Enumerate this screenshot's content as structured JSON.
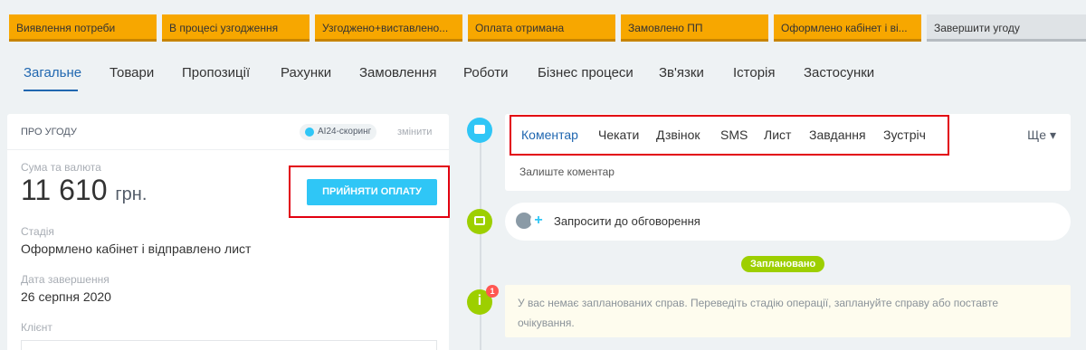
{
  "pipeline": {
    "stages": [
      {
        "label": "Виявлення потреби"
      },
      {
        "label": "В процесі узгодження"
      },
      {
        "label": "Узгоджено+виставлено..."
      },
      {
        "label": "Оплата отримана"
      },
      {
        "label": "Замовлено ПП"
      },
      {
        "label": "Оформлено кабінет і ві..."
      },
      {
        "label": "Завершити угоду"
      }
    ],
    "active_color": "#f7a700",
    "final_color": "#dfe3e6"
  },
  "tabs": [
    {
      "label": "Загальне",
      "active": true
    },
    {
      "label": "Товари"
    },
    {
      "label": "Пропозиції"
    },
    {
      "label": "Рахунки"
    },
    {
      "label": "Замовлення"
    },
    {
      "label": "Роботи"
    },
    {
      "label": "Бізнес процеси"
    },
    {
      "label": "Зв'язки"
    },
    {
      "label": "Історія"
    },
    {
      "label": "Застосунки"
    }
  ],
  "deal": {
    "title": "ПРО УГОДУ",
    "scoring_badge": "AI24-скоринг",
    "change_link": "змінити",
    "sum_label": "Сума та валюта",
    "sum_value": "11 610",
    "currency": "грн.",
    "accept_button": "ПРИЙНЯТИ ОПЛАТУ",
    "stage_label": "Стадія",
    "stage_value": "Оформлено кабінет і відправлено лист",
    "close_date_label": "Дата завершення",
    "close_date_value": "26 серпня 2020",
    "client_label": "Клієнт"
  },
  "activity": {
    "tabs": [
      {
        "label": "Коментар",
        "active": true
      },
      {
        "label": "Чекати"
      },
      {
        "label": "Дзвінок"
      },
      {
        "label": "SMS"
      },
      {
        "label": "Лист"
      },
      {
        "label": "Завдання"
      },
      {
        "label": "Зустріч"
      }
    ],
    "more": "Ще",
    "comment_placeholder": "Залиште коментар",
    "invite_label": "Запросити до обговорення",
    "planned_badge": "Заплановано",
    "notification_count": "1",
    "empty_note": "У вас немає запланованих справ. Переведіть стадію операції, заплануйте справу або поставте очікування."
  },
  "colors": {
    "accent_blue": "#2fc6f6",
    "link_blue": "#2067b0",
    "green": "#9dcf00",
    "highlight_red": "#e20010"
  }
}
